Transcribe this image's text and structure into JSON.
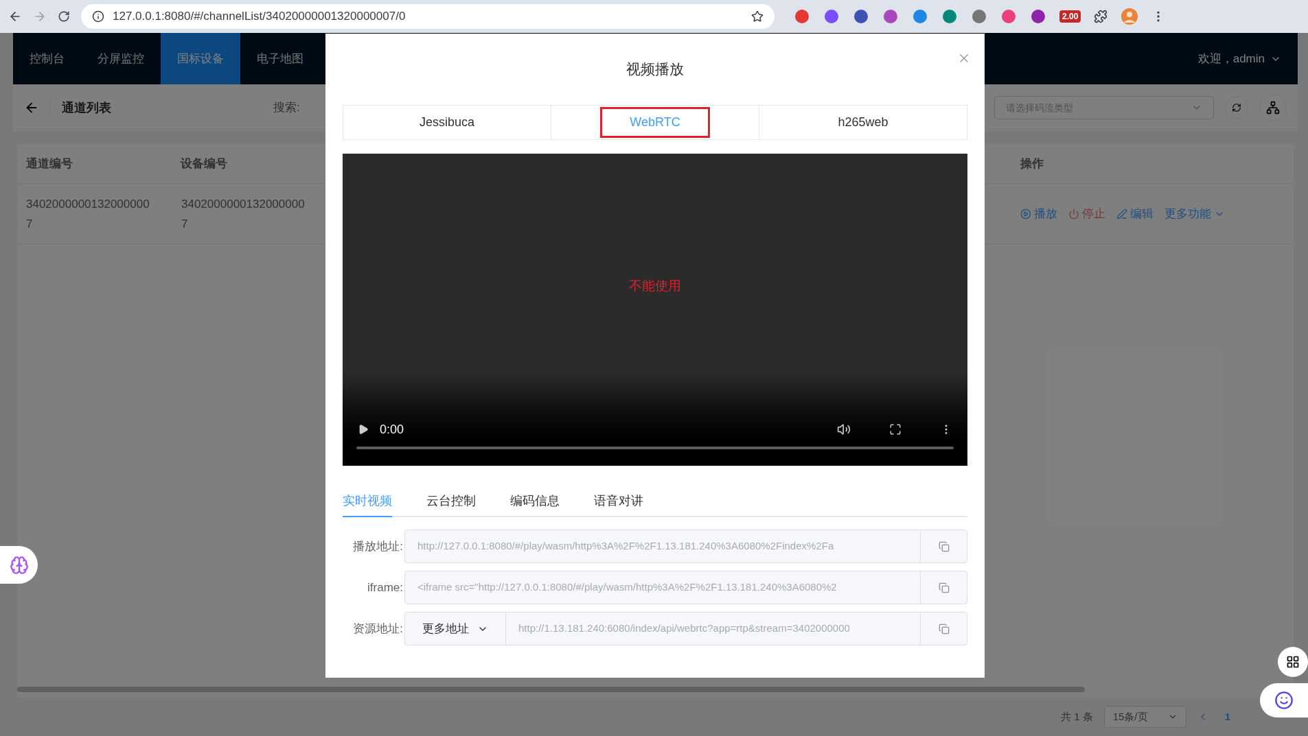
{
  "browser": {
    "url": "127.0.0.1:8080/#/channelList/34020000001320000007/0",
    "extension_badge": "2.00"
  },
  "header": {
    "nav": [
      {
        "label": "控制台",
        "selected": false
      },
      {
        "label": "分屏监控",
        "selected": false
      },
      {
        "label": "国标设备",
        "selected": true
      },
      {
        "label": "电子地图",
        "selected": false
      }
    ],
    "user": "欢迎，admin"
  },
  "toolbar": {
    "title": "通道列表",
    "search_label": "搜索:",
    "stream_select": {
      "placeholder": "请选择码流类型"
    }
  },
  "table": {
    "columns": [
      "通道编号",
      "设备编号",
      "操作"
    ],
    "rows": [
      {
        "cells": [
          "34020000001320000007",
          "34020000001320000007"
        ],
        "actions": [
          {
            "label": "播放",
            "kind": "play"
          },
          {
            "label": "停止",
            "kind": "stop"
          },
          {
            "label": "编辑",
            "kind": "edit"
          },
          {
            "label": "更多功能",
            "kind": "more"
          }
        ]
      }
    ]
  },
  "pagination": {
    "total": "共 1 条",
    "page_size": "15条/页",
    "pages": [
      {
        "label": "1",
        "selected": true
      }
    ]
  },
  "dialog": {
    "title": "视频播放",
    "players": [
      {
        "label": "Jessibuca",
        "selected": false
      },
      {
        "label": "WebRTC",
        "selected": true
      },
      {
        "label": "h265web",
        "selected": false
      }
    ],
    "video": {
      "message": "不能使用",
      "time": "0:00"
    },
    "tabs": [
      {
        "label": "实时视频",
        "selected": true
      },
      {
        "label": "云台控制",
        "selected": false
      },
      {
        "label": "编码信息",
        "selected": false
      },
      {
        "label": "语音对讲",
        "selected": false
      }
    ],
    "fields": [
      {
        "kind": "text",
        "label": "播放地址:",
        "value": "http://127.0.0.1:8080/#/play/wasm/http%3A%2F%2F1.13.181.240%3A6080%2Findex%2Fa"
      },
      {
        "kind": "text",
        "label": "iframe:",
        "value": "<iframe src=\"http://127.0.0.1:8080/#/play/wasm/http%3A%2F%2F1.13.181.240%3A6080%2"
      },
      {
        "kind": "select",
        "label": "资源地址:",
        "select": "更多地址",
        "value": "http://1.13.181.240:6080/index/api/webrtc?app=rtp&stream=3402000000"
      }
    ]
  }
}
